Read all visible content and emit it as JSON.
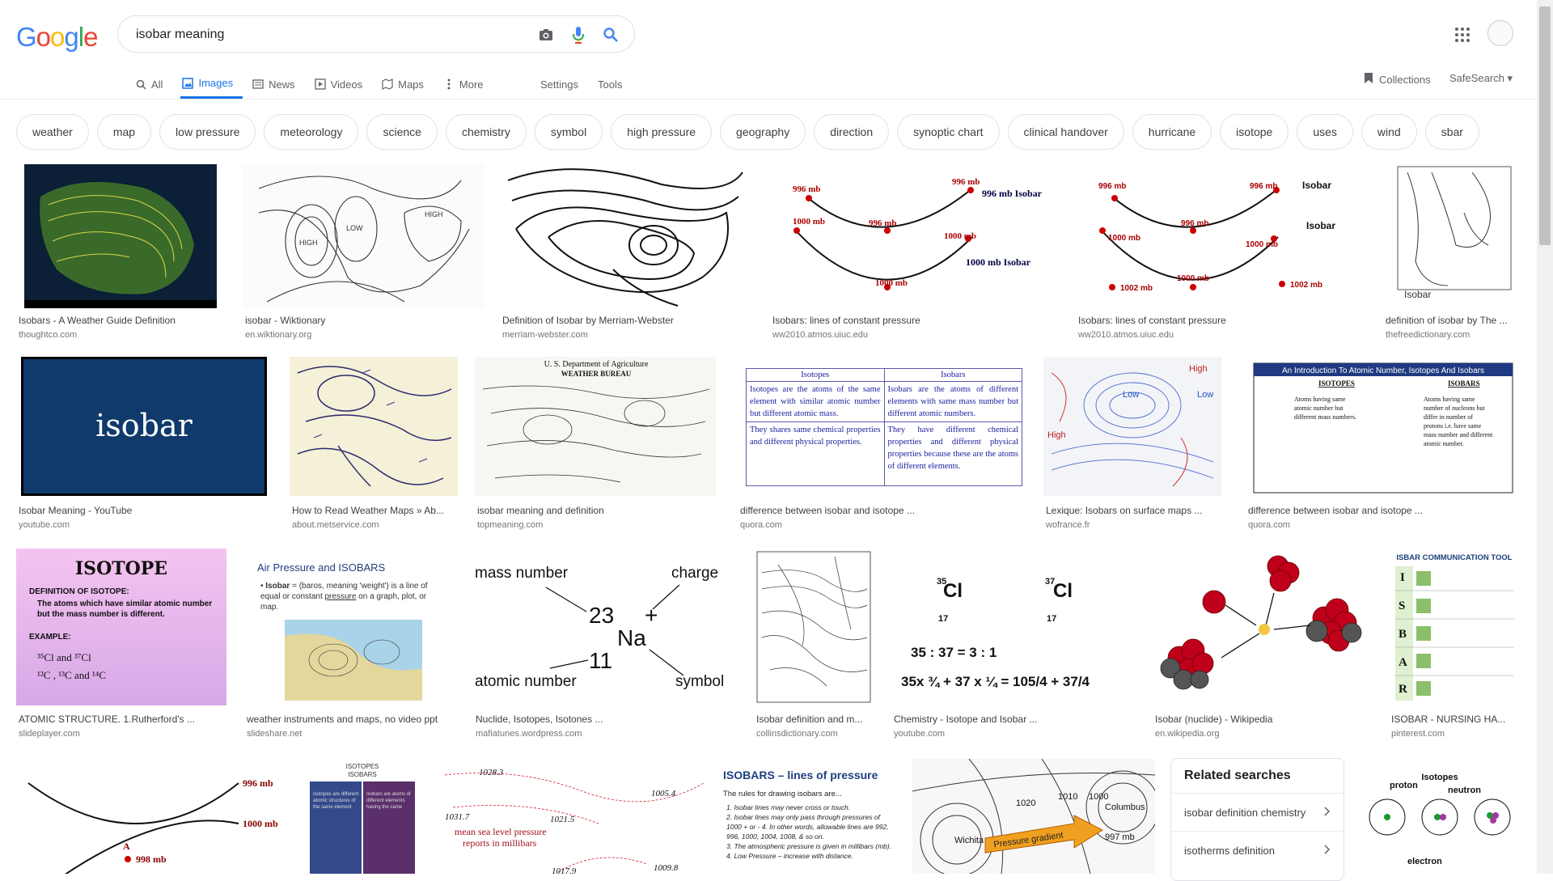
{
  "logo": [
    "G",
    "o",
    "o",
    "g",
    "l",
    "e"
  ],
  "search": {
    "query": "isobar meaning",
    "camera_icon": "camera-icon",
    "mic_icon": "mic-icon",
    "search_icon": "search-icon"
  },
  "tabs": [
    {
      "label": "All",
      "icon": "search-icon"
    },
    {
      "label": "Images",
      "icon": "image-icon",
      "active": true
    },
    {
      "label": "News",
      "icon": "news-icon"
    },
    {
      "label": "Videos",
      "icon": "video-icon"
    },
    {
      "label": "Maps",
      "icon": "map-icon"
    },
    {
      "label": "More",
      "icon": "more-icon"
    }
  ],
  "tools": {
    "settings": "Settings",
    "tools": "Tools"
  },
  "collections": "Collections",
  "safesearch": "SafeSearch ▾",
  "chips": [
    "weather",
    "map",
    "low pressure",
    "meteorology",
    "science",
    "chemistry",
    "symbol",
    "high pressure",
    "geography",
    "direction",
    "synoptic chart",
    "clinical handover",
    "hurricane",
    "isotope",
    "uses",
    "wind",
    "sbar"
  ],
  "results": [
    {
      "caption": "Isobars - A Weather Guide Definition",
      "source": "thoughtco.com"
    },
    {
      "caption": "isobar - Wiktionary",
      "source": "en.wiktionary.org"
    },
    {
      "caption": "Definition of Isobar by Merriam-Webster",
      "source": "merriam-webster.com"
    },
    {
      "caption": "Isobars: lines of constant pressure",
      "source": "ww2010.atmos.uiuc.edu"
    },
    {
      "caption": "Isobars: lines of constant pressure",
      "source": "ww2010.atmos.uiuc.edu"
    },
    {
      "caption": "definition of isobar by The ...",
      "source": "thefreedictionary.com"
    },
    {
      "caption": "Isobar Meaning - YouTube",
      "source": "youtube.com"
    },
    {
      "caption": "How to Read Weather Maps » Ab...",
      "source": "about.metservice.com"
    },
    {
      "caption": "isobar meaning and definition",
      "source": "topmeaning.com"
    },
    {
      "caption": "difference between isobar and isotope ...",
      "source": "quora.com"
    },
    {
      "caption": "Lexique: Isobars on surface maps ...",
      "source": "wofrance.fr"
    },
    {
      "caption": "difference between isobar and isotope ...",
      "source": "quora.com"
    },
    {
      "caption": "ATOMIC STRUCTURE. 1.Rutherford's ...",
      "source": "slideplayer.com"
    },
    {
      "caption": "weather instruments and maps, no video ppt",
      "source": "slideshare.net"
    },
    {
      "caption": "Nuclide, Isotopes, Isotones ...",
      "source": "mafiatunes.wordpress.com"
    },
    {
      "caption": "Isobar definition and m...",
      "source": "collinsdictionary.com"
    },
    {
      "caption": "Chemistry - Isotope and Isobar ...",
      "source": "youtube.com"
    },
    {
      "caption": "Isobar (nuclide) - Wikipedia",
      "source": "en.wikipedia.org"
    },
    {
      "caption": "ISOBAR - NURSING HA...",
      "source": "pinterest.com"
    }
  ],
  "thumb_text": {
    "isobar_title": "isobar",
    "isotope_title": "ISOTOPE",
    "isotope_def": "DEFINITION OF ISOTOPE:",
    "isotope_body1": "The atoms which have similar atomic number",
    "isotope_body2": "but the mass number is different.",
    "isotope_example": "EXAMPLE:",
    "air_title": "Air Pressure and ISOBARS",
    "na_mass": "mass number",
    "na_charge": "charge",
    "na_atomic": "atomic number",
    "na_symbol": "symbol",
    "na_23": "23",
    "na_11": "11",
    "na_sym": "Na",
    "na_plus": "+",
    "cl_ratio": "35 : 37 = 3 : 1",
    "cl_calc": "35x ¾  + 37 x ¼ = 105/4  + 37/4",
    "isobars_lines": "ISOBARS – lines of pressure",
    "isobars_rules": "The rules for drawing isobars are...",
    "isotopes_header": "Isotopes",
    "isobars_header": "Isobars",
    "isotopes_def": "Isotopes are the atoms of the same element with similar atomic number but different atomic mass.",
    "isobars_def": "Isobars are the atoms of different elements with same mass number but different atomic numbers.",
    "isotopes_prop": "They shares same chemical properties and different physical properties.",
    "isobars_prop": "They have different chemical properties and different physical properties because these are the atoms of different elements.",
    "intro_title": "An Introduction To Atomic Number, Isotopes And Isobars",
    "mb996": "996 mb",
    "mb1000": "1000 mb",
    "mb1002": "1002 mb",
    "isobar_label": "Isobar",
    "mb996_isobar": "996 mb Isobar",
    "mb1000_isobar": "1000 mb Isobar",
    "mb998": "998 mb",
    "sbar": "ISBAR COMMUNICATION TOOL",
    "dept": "U. S. Department of Agriculture",
    "bureau": "WEATHER BUREAU",
    "msl": "mean sea level pressure",
    "millibars": "reports in millibars",
    "pressure_gradient": "Pressure gradient",
    "wichita": "Wichita",
    "columbus": "Columbus",
    "proton": "proton",
    "neutron": "neutron",
    "electron": "electron",
    "isotopes_lbl": "Isotopes"
  },
  "related": {
    "title": "Related searches",
    "items": [
      "isobar definition chemistry",
      "isotherms definition"
    ]
  }
}
